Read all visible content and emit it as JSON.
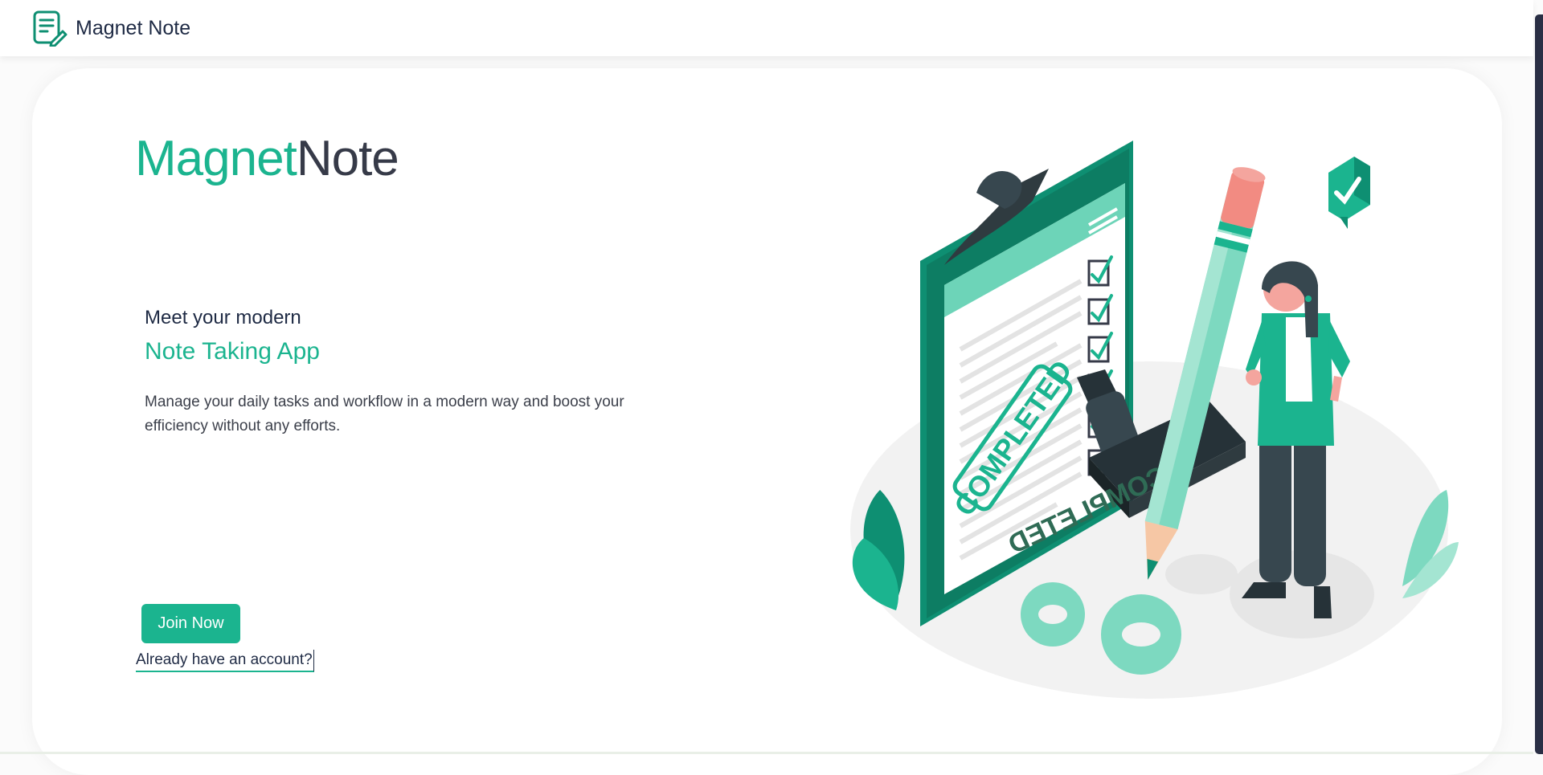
{
  "navbar": {
    "brand_name": "Magnet Note",
    "brand_icon": "note-pencil-icon"
  },
  "hero": {
    "logo_part1": "Magnet",
    "logo_part2": "Note",
    "tagline": "Meet your modern",
    "headline": "Note Taking App",
    "description": "Manage your daily tasks and workflow in a modern way and boost your efficiency without any efforts.",
    "join_button": "Join Now",
    "login_link": "Already have an account?"
  },
  "illustration": {
    "stamp_text": "COMPLETED",
    "stamp_mirror_text": "COMPLETED",
    "icon": "completed-checklist-illustration"
  },
  "colors": {
    "accent": "#1bb48f",
    "dark_text": "#1e2a44",
    "logo_dark": "#363a48"
  }
}
